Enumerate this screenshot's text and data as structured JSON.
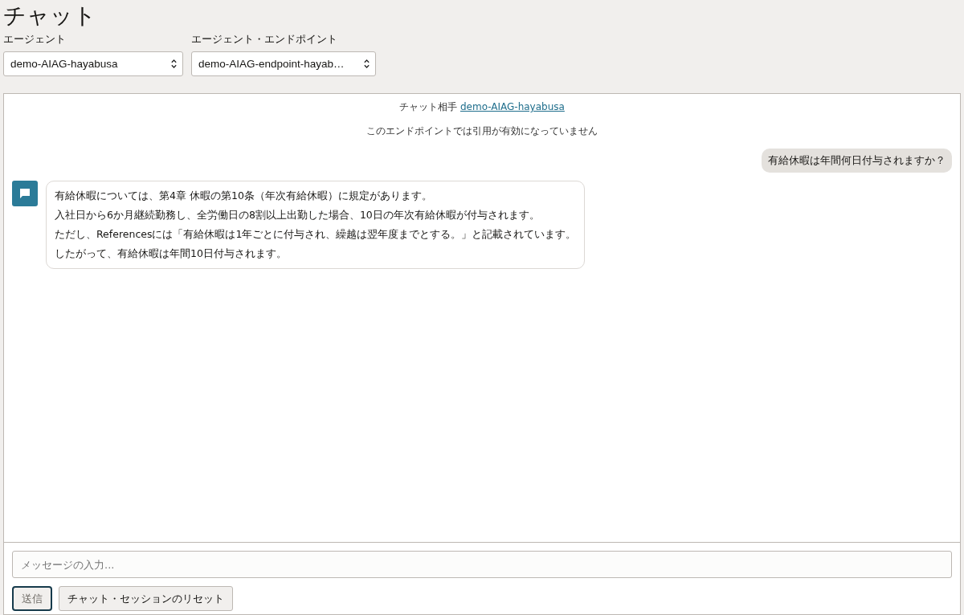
{
  "page": {
    "title": "チャット"
  },
  "selectors": [
    {
      "label": "エージェント",
      "value": "demo-AIAG-hayabusa"
    },
    {
      "label": "エージェント・エンドポイント",
      "value": "demo-AIAG-endpoint-hayab…"
    }
  ],
  "chat": {
    "header": {
      "prefix": "チャット相手",
      "agent_link": "demo-AIAG-hayabusa",
      "notice": "このエンドポイントでは引用が有効になっていません"
    },
    "messages": [
      {
        "kind": "user",
        "lines": [
          "有給休暇は年間何日付与されますか？"
        ]
      },
      {
        "kind": "agent",
        "lines": [
          "有給休暇については、第4章 休暇の第10条（年次有給休暇）に規定があります。",
          "入社日から6か月継続勤務し、全労働日の8割以上出勤した場合、10日の年次有給休暇が付与されます。",
          "ただし、Referencesには「有給休暇は1年ごとに付与され、繰越は翌年度までとする。」と記載されています。",
          "したがって、有給休暇は年間10日付与されます。"
        ]
      }
    ]
  },
  "composer": {
    "placeholder": "メッセージの入力...",
    "buttons": [
      {
        "label": "送信",
        "disabled": true,
        "focused": true
      },
      {
        "label": "チャット・セッションのリセット",
        "disabled": false,
        "focused": false
      }
    ]
  }
}
